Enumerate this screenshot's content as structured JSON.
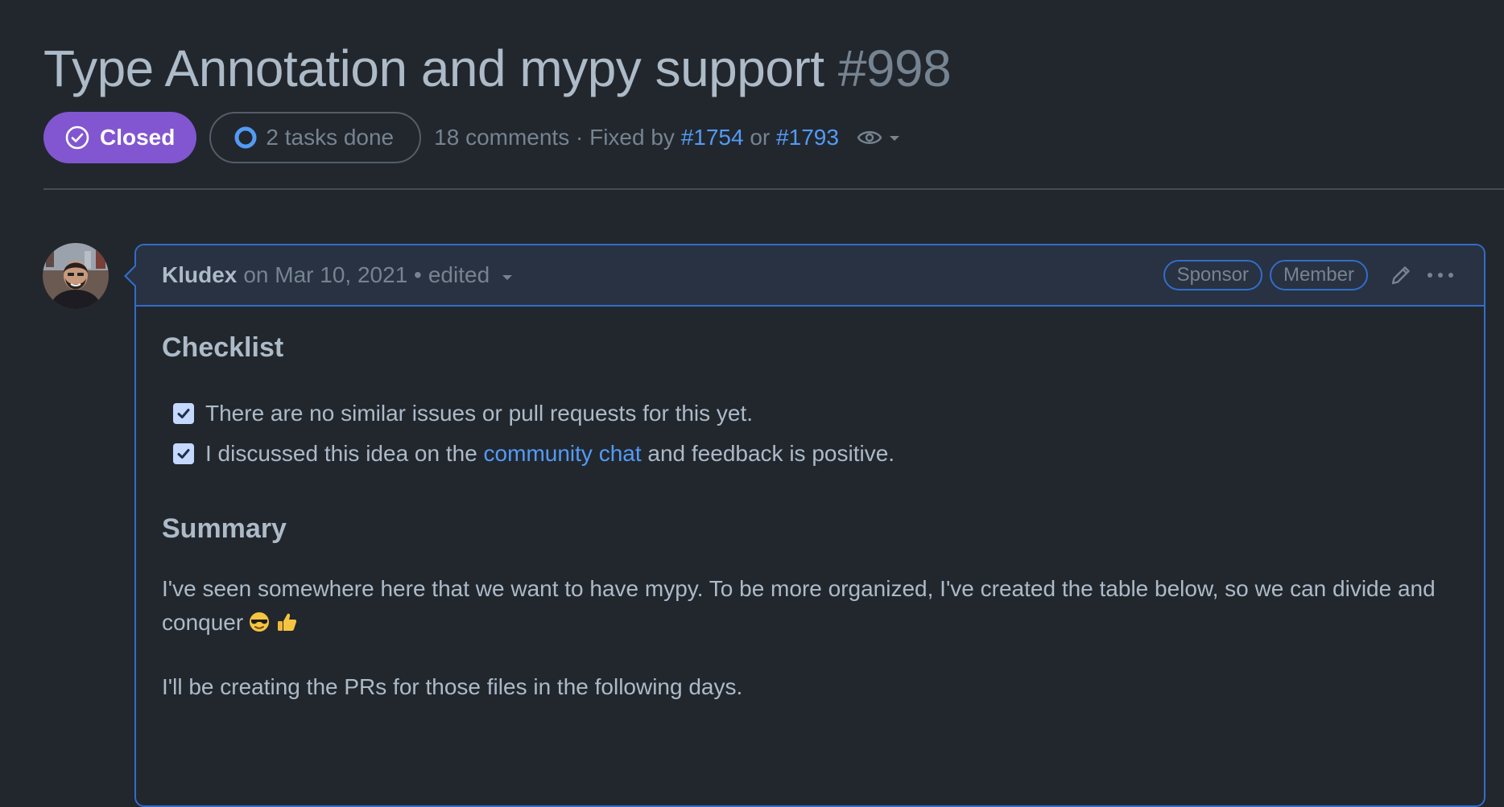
{
  "issue": {
    "title": "Type Annotation and mypy support",
    "number": "#998",
    "state": "Closed",
    "tasks": "2 tasks done",
    "comments_prefix": "18 comments · Fixed by",
    "fixed_by_1": "#1754",
    "or_text": "or",
    "fixed_by_2": "#1793"
  },
  "comment": {
    "author": "Kludex",
    "date_text": "on Mar 10, 2021 •",
    "edited": "edited",
    "badges": [
      "Sponsor",
      "Member"
    ],
    "checklist_heading": "Checklist",
    "tasks": [
      {
        "checked": true,
        "text": "There are no similar issues or pull requests for this yet."
      },
      {
        "checked": true,
        "before": "I discussed this idea on the",
        "link": "community chat",
        "after": "and feedback is positive."
      }
    ],
    "summary_heading": "Summary",
    "paragraph_1": "I've seen somewhere here that we want to have mypy. To be more organized, I've created the table below, so we can divide and conquer",
    "paragraph_2": "I'll be creating the PRs for those files in the following days."
  },
  "colors": {
    "background": "#22272e",
    "closed_badge": "#8256d0",
    "link": "#539bf5",
    "comment_border": "#316dca",
    "header_bg": "#283242"
  },
  "icons": {
    "state": "check-circle-icon",
    "tasks": "circle-progress-icon",
    "watch": "eye-icon",
    "edit": "pencil-icon",
    "more": "kebab-horizontal-icon",
    "emoji_1": "sunglasses-emoji",
    "emoji_2": "thumbs-up-emoji"
  }
}
